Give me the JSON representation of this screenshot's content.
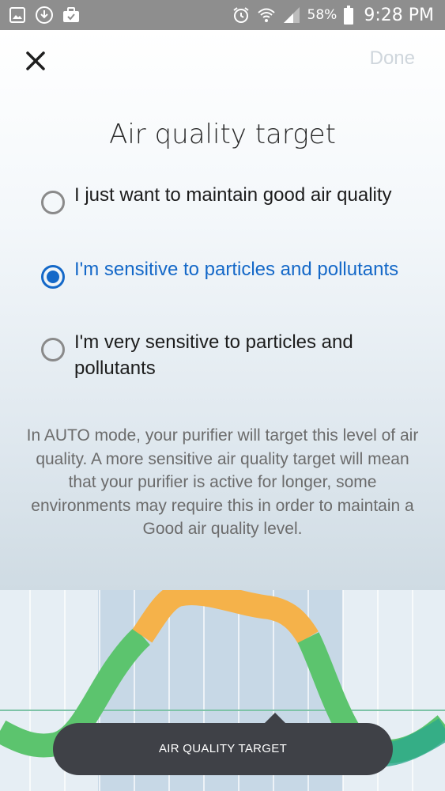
{
  "status_bar": {
    "battery_percent": "58%",
    "time": "9:28 PM",
    "left_icons": [
      "image-icon",
      "download-icon",
      "briefcase-icon"
    ],
    "right_icons": [
      "alarm-icon",
      "wifi-icon",
      "signal-icon",
      "battery-icon"
    ]
  },
  "header": {
    "close_icon": "close-icon",
    "done_label": "Done",
    "title": "Air quality target"
  },
  "options": [
    {
      "label": "I just want to maintain good air quality",
      "selected": false
    },
    {
      "label": "I'm sensitive to particles and pollutants",
      "selected": true
    },
    {
      "label": "I'm very sensitive to particles and pollutants",
      "selected": false
    }
  ],
  "description": "In AUTO mode, your purifier will target this level of air quality. A more sensitive air quality target will mean that your purifier is active for longer, some environments may require this in order to maintain a Good air quality level.",
  "chart": {
    "colors": {
      "good": "#5cc46e",
      "fair": "#f5b24a",
      "teal": "#2ca98c",
      "highlight": "#c7d8e6",
      "background": "#e6eef4"
    }
  },
  "target_pill": {
    "label": "AIR QUALITY TARGET"
  }
}
